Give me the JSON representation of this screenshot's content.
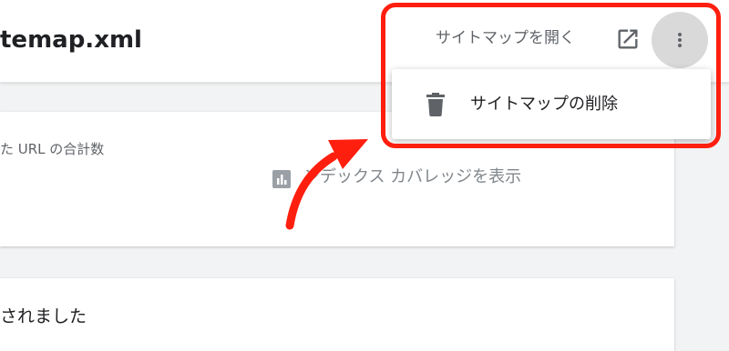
{
  "header": {
    "title": "temap.xml",
    "open_sitemap_label": "サイトマップを開く",
    "open_icon": "open-in-new-icon",
    "more_icon": "more-vert-icon"
  },
  "dropdown": {
    "items": [
      {
        "label": "サイトマップの削除",
        "icon": "trash-icon"
      }
    ]
  },
  "card": {
    "label": "た URL の合計数",
    "coverage_link": "ンデックス カバレッジを表示",
    "coverage_icon": "bar-chart-icon"
  },
  "status": {
    "text": "されました"
  },
  "colors": {
    "highlight": "#ff1f0f",
    "muted_text": "#5f6368",
    "background": "#f1f3f4"
  }
}
